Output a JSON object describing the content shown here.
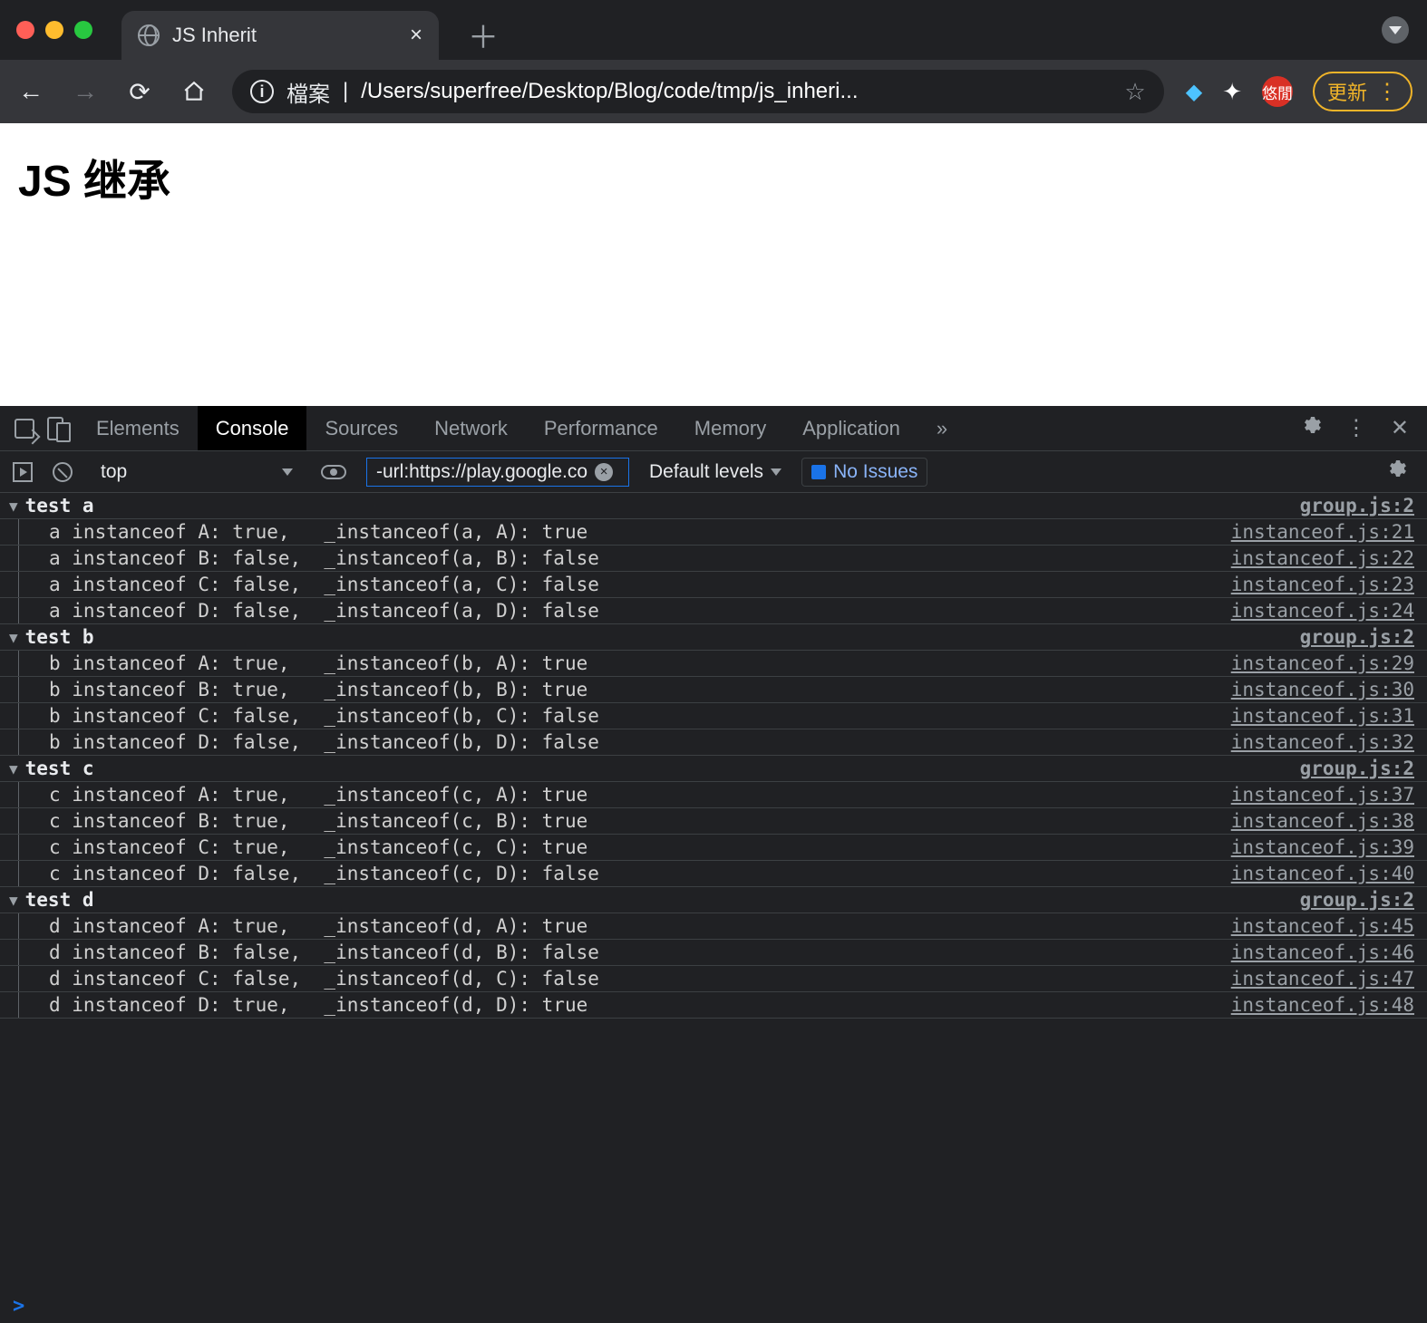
{
  "browser": {
    "tab_title": "JS Inherit",
    "url_label_prefix": "檔案",
    "url_path": "/Users/superfree/Desktop/Blog/code/tmp/js_inheri...",
    "update_label": "更新",
    "ext_badge_text": "悠閒"
  },
  "page": {
    "heading": "JS 继承"
  },
  "devtools": {
    "tabs": [
      "Elements",
      "Console",
      "Sources",
      "Network",
      "Performance",
      "Memory",
      "Application"
    ],
    "active_tab": "Console",
    "context_label": "top",
    "filter_value": "-url:https://play.google.co",
    "levels_label": "Default levels",
    "issues_label": "No Issues"
  },
  "console": {
    "group_source": "group.js:2",
    "groups": [
      {
        "title": "test a",
        "rows": [
          {
            "msg": "a instanceof A: true,   _instanceof(a, A): true",
            "src": "instanceof.js:21"
          },
          {
            "msg": "a instanceof B: false,  _instanceof(a, B): false",
            "src": "instanceof.js:22"
          },
          {
            "msg": "a instanceof C: false,  _instanceof(a, C): false",
            "src": "instanceof.js:23"
          },
          {
            "msg": "a instanceof D: false,  _instanceof(a, D): false",
            "src": "instanceof.js:24"
          }
        ]
      },
      {
        "title": "test b",
        "rows": [
          {
            "msg": "b instanceof A: true,   _instanceof(b, A): true",
            "src": "instanceof.js:29"
          },
          {
            "msg": "b instanceof B: true,   _instanceof(b, B): true",
            "src": "instanceof.js:30"
          },
          {
            "msg": "b instanceof C: false,  _instanceof(b, C): false",
            "src": "instanceof.js:31"
          },
          {
            "msg": "b instanceof D: false,  _instanceof(b, D): false",
            "src": "instanceof.js:32"
          }
        ]
      },
      {
        "title": "test c",
        "rows": [
          {
            "msg": "c instanceof A: true,   _instanceof(c, A): true",
            "src": "instanceof.js:37"
          },
          {
            "msg": "c instanceof B: true,   _instanceof(c, B): true",
            "src": "instanceof.js:38"
          },
          {
            "msg": "c instanceof C: true,   _instanceof(c, C): true",
            "src": "instanceof.js:39"
          },
          {
            "msg": "c instanceof D: false,  _instanceof(c, D): false",
            "src": "instanceof.js:40"
          }
        ]
      },
      {
        "title": "test d",
        "rows": [
          {
            "msg": "d instanceof A: true,   _instanceof(d, A): true",
            "src": "instanceof.js:45"
          },
          {
            "msg": "d instanceof B: false,  _instanceof(d, B): false",
            "src": "instanceof.js:46"
          },
          {
            "msg": "d instanceof C: false,  _instanceof(d, C): false",
            "src": "instanceof.js:47"
          },
          {
            "msg": "d instanceof D: true,   _instanceof(d, D): true",
            "src": "instanceof.js:48"
          }
        ]
      }
    ]
  }
}
